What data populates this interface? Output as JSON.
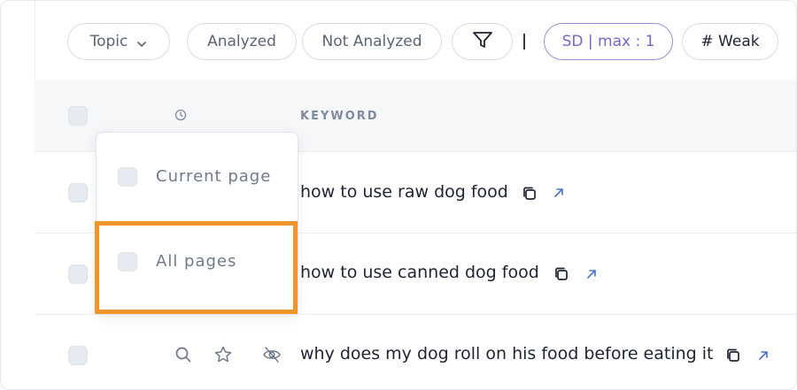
{
  "filters": {
    "topic_label": "Topic",
    "analyzed_label": "Analyzed",
    "not_analyzed_label": "Not Analyzed",
    "sd_label": "SD | max : 1",
    "weak_label": "# Weak"
  },
  "table": {
    "keyword_header": "KEYWORD",
    "rows": [
      {
        "keyword": "how to use raw dog food"
      },
      {
        "keyword": "how to use canned dog food"
      },
      {
        "keyword": "why does my dog roll on his food before eating it"
      }
    ]
  },
  "select_menu": {
    "current_page": "Current page",
    "all_pages": "All pages"
  },
  "colors": {
    "accent_highlight": "#f0952c",
    "sd_accent": "#7766c8",
    "link_icon": "#4a6fd8"
  }
}
